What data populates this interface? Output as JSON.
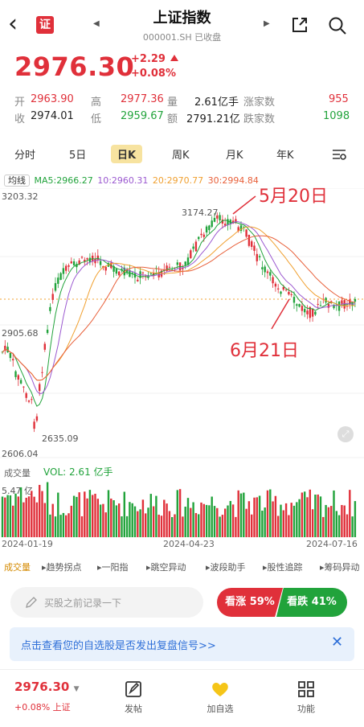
{
  "header": {
    "title": "上证指数",
    "code_status": "000001.SH 已收盘",
    "logo_text": "证"
  },
  "quote": {
    "price": "2976.30",
    "change": "+2.29",
    "change_pct": "+0.08%",
    "open_label": "开",
    "open": "2963.90",
    "high_label": "高",
    "high": "2977.36",
    "volume_label": "量",
    "volume": "2.61亿手",
    "up_label": "涨家数",
    "up": "955",
    "close_label": "收",
    "close": "2974.01",
    "low_label": "低",
    "low": "2959.67",
    "amount_label": "额",
    "amount": "2791.21亿",
    "down_label": "跌家数",
    "down": "1098"
  },
  "tabs": [
    "分时",
    "5日",
    "日K",
    "周K",
    "月K",
    "年K"
  ],
  "active_tab": "日K",
  "ma": {
    "button": "均线",
    "ma5": "MA5:2966.27",
    "ma10": "10:2960.31",
    "ma20": "20:2970.77",
    "ma30": "30:2994.84"
  },
  "colors": {
    "up": "#e0303a",
    "down": "#21a33b",
    "ma5": "#21a33b",
    "ma10": "#9b59d0",
    "ma20": "#f0a030",
    "ma30": "#e8603a"
  },
  "chart_labels": {
    "y_top": "3203.32",
    "y_mid": "2905.68",
    "y_bottom": "2606.04",
    "peak": "3174.27",
    "trough": "2635.09",
    "annotation_1": "5月20日",
    "annotation_2": "6月21日"
  },
  "chart_data": {
    "type": "candlestick",
    "ylim": [
      2606.04,
      3203.32
    ],
    "x_labels": [
      "2024-01-19",
      "2024-04-23",
      "2024-07-16"
    ],
    "ma_series": [
      "MA5",
      "MA10",
      "MA20",
      "MA30"
    ],
    "annotations": [
      "5月20日",
      "6月21日"
    ]
  },
  "volume": {
    "label": "成交量",
    "vol": "VOL: 2.61 亿手",
    "max": "5.47 亿"
  },
  "x_axis": [
    "2024-01-19",
    "2024-04-23",
    "2024-07-16"
  ],
  "tools": [
    "成交量",
    "趋势拐点",
    "一阳指",
    "跳空异动",
    "波段助手",
    "股性追踪",
    "筹码异动"
  ],
  "note_placeholder": "买股之前记录一下",
  "sentiment": {
    "bull": "看涨 59%",
    "bear": "看跌 41%"
  },
  "banner": {
    "text": "点击查看您的自选股是否发出复盘信号>>",
    "close": "✕"
  },
  "bottom": {
    "price": "2976.30",
    "change": "+0.08% 上证",
    "post": "发帖",
    "watch": "加自选",
    "func": "功能"
  }
}
